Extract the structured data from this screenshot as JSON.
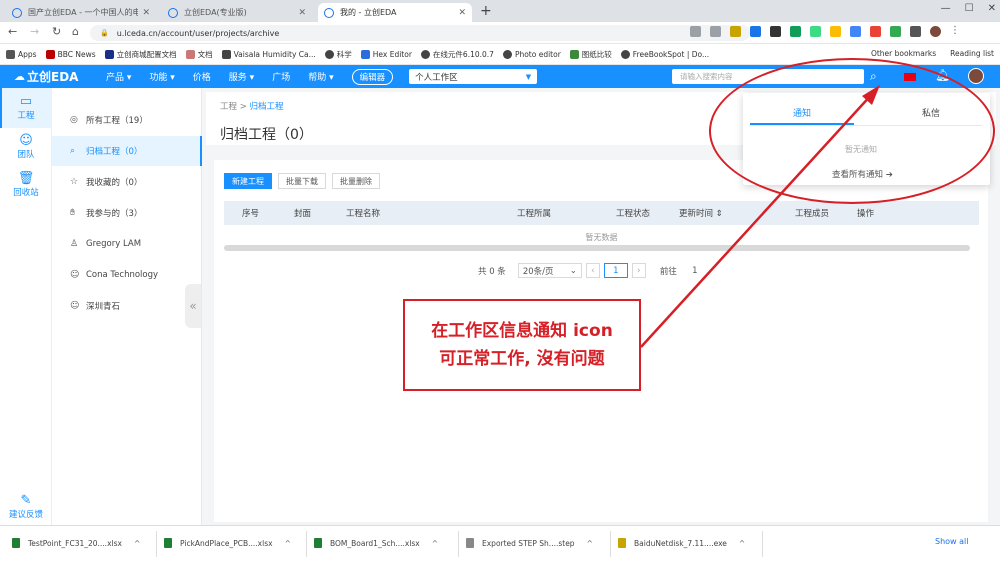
{
  "browser": {
    "tabs": [
      {
        "label": "国产立创EDA - 一个中国人的电路设计",
        "active": false
      },
      {
        "label": "立创EDA(专业版)",
        "active": false
      },
      {
        "label": "我的 - 立创EDA",
        "active": true
      }
    ],
    "url": "u.lceda.cn/account/user/projects/archive",
    "bookmarks": [
      "Apps",
      "BBC News",
      "立创商城配置文档",
      "文档",
      "Vaisala Humidity Ca...",
      "科学",
      "Hex Editor",
      "在线元件6.10.0.7",
      "Photo editor",
      "图纸比较",
      "FreeBookSpot | Do..."
    ],
    "bookmarks_right": [
      "Other bookmarks",
      "Reading list"
    ]
  },
  "header": {
    "logo": "立创EDA",
    "menus": [
      "产品 ▾",
      "功能 ▾",
      "价格",
      "服务 ▾",
      "广场",
      "帮助 ▾"
    ],
    "editor_button": "编辑器",
    "workspace": "个人工作区",
    "search_placeholder": "请输入搜索内容"
  },
  "iconbar": [
    {
      "label": "工程",
      "icon": "folder-icon"
    },
    {
      "label": "团队",
      "icon": "team-icon"
    },
    {
      "label": "回收站",
      "icon": "trash-icon"
    },
    {
      "label": "建议反馈",
      "icon": "feedback-icon"
    }
  ],
  "project_nav": [
    {
      "label": "所有工程（19）",
      "icon": "target-icon",
      "active": false
    },
    {
      "label": "归档工程（0）",
      "icon": "archive-icon",
      "active": true
    },
    {
      "label": "我收藏的（0）",
      "icon": "star-icon",
      "active": false
    },
    {
      "label": "我参与的（3）",
      "icon": "hand-icon",
      "active": false
    },
    {
      "label": "Gregory LAM",
      "icon": "user-icon",
      "active": false
    },
    {
      "label": "Cona Technology",
      "icon": "group-icon",
      "active": false
    },
    {
      "label": "深圳青石",
      "icon": "group-icon",
      "active": false
    }
  ],
  "content": {
    "breadcrumb_root": "工程",
    "breadcrumb_sep": ">",
    "breadcrumb_current": "归档工程",
    "title": "归档工程（0）",
    "buttons": {
      "new": "新建工程",
      "download": "批量下载",
      "delete": "批量删除"
    },
    "table_headers": [
      "序号",
      "封面",
      "工程名称",
      "工程所属",
      "工程状态",
      "更新时间 ⇕",
      "工程成员",
      "操作"
    ],
    "empty_text": "暂无数据",
    "pager": {
      "total": "共 0 条",
      "page_size": "20条/页",
      "current_page": "1",
      "goto_label": "前往",
      "goto_value": "1"
    }
  },
  "notifications": {
    "tab_notice": "通知",
    "tab_message": "私信",
    "empty": "暂无通知",
    "view_all": "查看所有通知 ➔"
  },
  "callout": {
    "line1": "在工作区信息通知 icon",
    "line2": "可正常工作, 沒有问题",
    "color": "#d61f26"
  },
  "downloads": [
    {
      "name": "TestPoint_FC31_20....xlsx"
    },
    {
      "name": "PickAndPlace_PCB....xlsx"
    },
    {
      "name": "BOM_Board1_Sch....xlsx"
    },
    {
      "name": "Exported STEP Sh....step"
    },
    {
      "name": "BaiduNetdisk_7.11....exe"
    }
  ],
  "show_all": "Show all",
  "colors": {
    "primary": "#1890ff",
    "annotation": "#d61f26"
  }
}
